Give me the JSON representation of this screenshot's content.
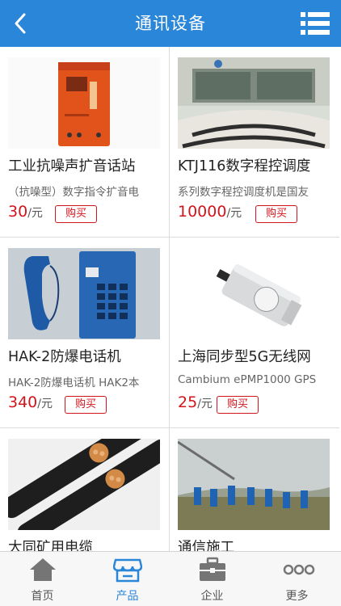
{
  "header": {
    "title": "通讯设备",
    "back_icon": "back-arrow-icon",
    "menu_icon": "list-menu-icon"
  },
  "products": [
    {
      "name": "工业抗噪声扩音话站",
      "desc": "（抗噪型）数字指令扩音电",
      "price": "30",
      "unit": "/元",
      "buy": "购买"
    },
    {
      "name": "KTJ116数字程控调度",
      "desc": "系列数字程控调度机是国友",
      "price": "10000",
      "unit": "/元",
      "buy": "购买"
    },
    {
      "name": "HAK-2防爆电话机",
      "desc": "HAK-2防爆电话机 HAK2本",
      "price": "340",
      "unit": "/元",
      "buy": "购买"
    },
    {
      "name": "上海同步型5G无线网",
      "desc": "Cambium ePMP1000 GPS",
      "price": "25",
      "unit": "/元",
      "buy": "购买"
    },
    {
      "name": "大同矿用电缆",
      "desc": "",
      "price": "",
      "unit": "",
      "buy": ""
    },
    {
      "name": "通信施工",
      "desc": "",
      "price": "",
      "unit": "",
      "buy": ""
    }
  ],
  "tabs": [
    {
      "label": "首页",
      "icon": "home-icon"
    },
    {
      "label": "产品",
      "icon": "store-icon"
    },
    {
      "label": "企业",
      "icon": "briefcase-icon"
    },
    {
      "label": "更多",
      "icon": "more-dots-icon"
    }
  ],
  "colors": {
    "accent": "#2a86d8",
    "price": "#d2141c"
  }
}
